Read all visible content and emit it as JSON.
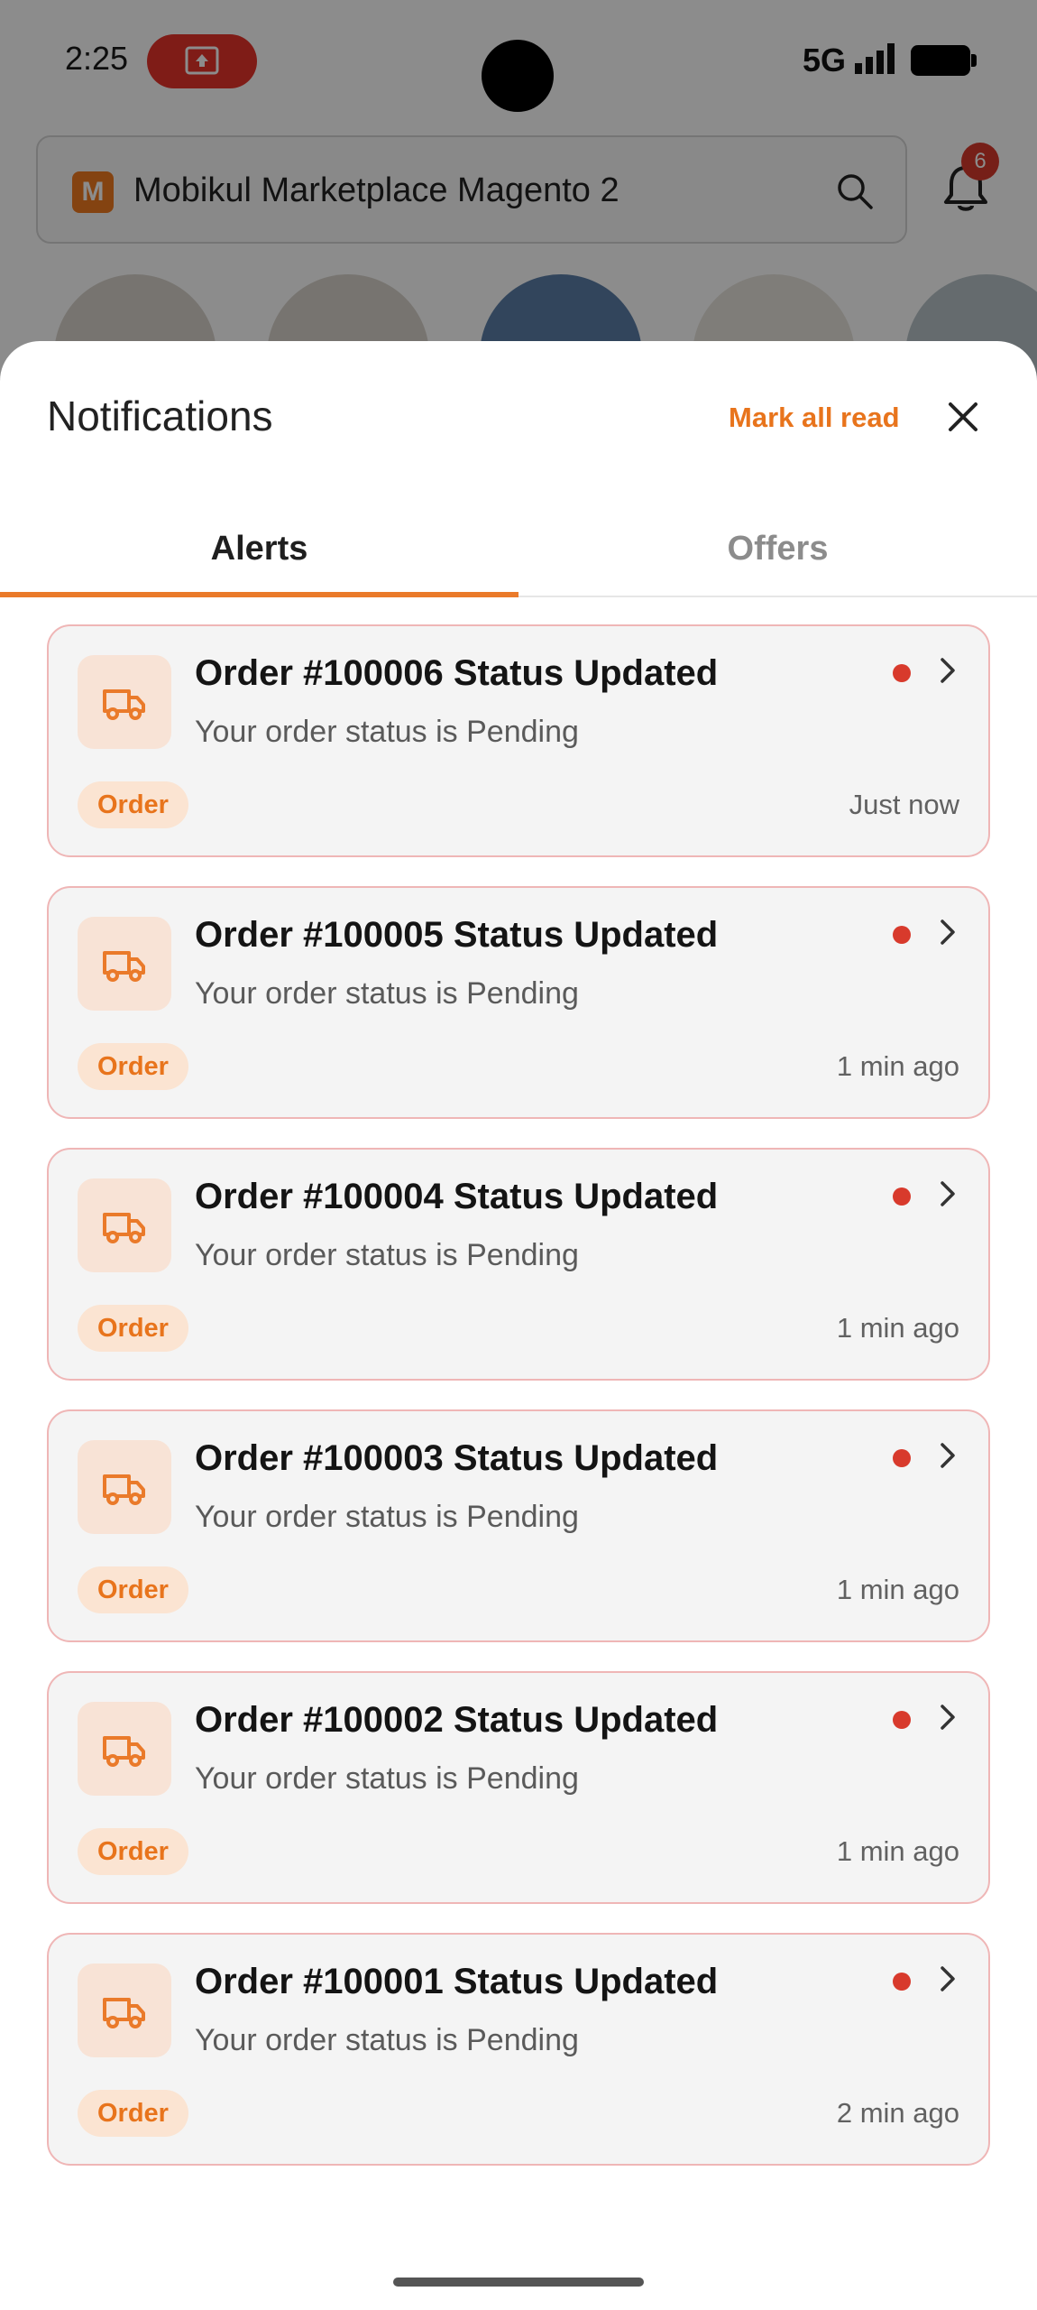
{
  "status_bar": {
    "time": "2:25",
    "network": "5G"
  },
  "background_app": {
    "search_text": "Mobikul Marketplace Magento 2",
    "notification_count": "6",
    "brand_logo_letter": "M"
  },
  "sheet": {
    "title": "Notifications",
    "mark_all_read": "Mark all read",
    "tabs": [
      {
        "label": "Alerts",
        "active": true
      },
      {
        "label": "Offers",
        "active": false
      }
    ]
  },
  "notifications": [
    {
      "title": "Order #100006 Status Updated",
      "body": "Your order status is Pending",
      "tag": "Order",
      "time": "Just now",
      "unread": true
    },
    {
      "title": "Order #100005 Status Updated",
      "body": "Your order status is Pending",
      "tag": "Order",
      "time": "1 min ago",
      "unread": true
    },
    {
      "title": "Order #100004 Status Updated",
      "body": "Your order status is Pending",
      "tag": "Order",
      "time": "1 min ago",
      "unread": true
    },
    {
      "title": "Order #100003 Status Updated",
      "body": "Your order status is Pending",
      "tag": "Order",
      "time": "1 min ago",
      "unread": true
    },
    {
      "title": "Order #100002 Status Updated",
      "body": "Your order status is Pending",
      "tag": "Order",
      "time": "1 min ago",
      "unread": true
    },
    {
      "title": "Order #100001 Status Updated",
      "body": "Your order status is Pending",
      "tag": "Order",
      "time": "2 min ago",
      "unread": true
    }
  ],
  "colors": {
    "accent": "#ea7a2a",
    "unread_dot": "#d83a2c",
    "card_border": "#efb6b6"
  },
  "icons": {
    "notification_icon": "truck-icon",
    "row_action": "chevron-right-icon",
    "close": "close-icon"
  }
}
